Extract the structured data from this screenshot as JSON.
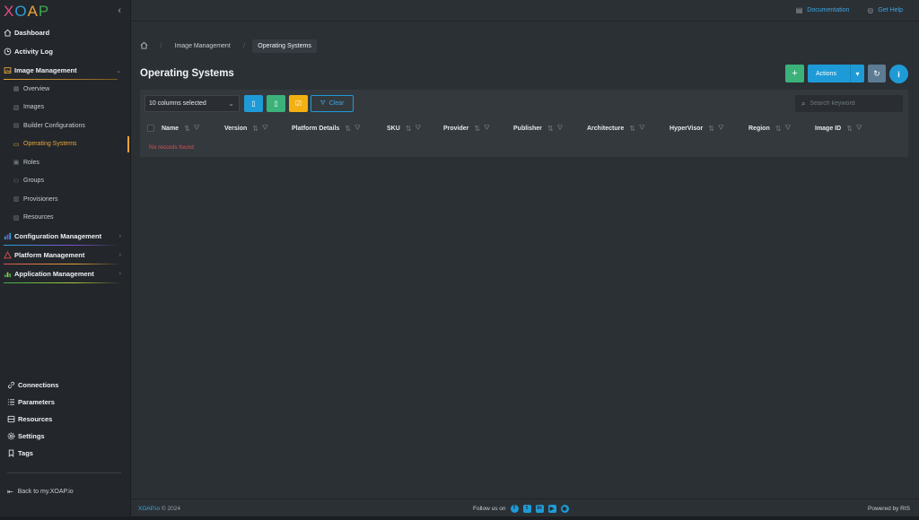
{
  "brand": {
    "logo_letters": [
      "X",
      "O",
      "A",
      "P"
    ],
    "logo_colors": [
      "#e24a8a",
      "#2a9fd6",
      "#e8a33a",
      "#3ea84f"
    ]
  },
  "sidebar": {
    "collapse_icon": "chevron-left-icon",
    "items": [
      {
        "label": "Dashboard",
        "icon": "home-icon"
      },
      {
        "label": "Activity Log",
        "icon": "clock-icon"
      },
      {
        "label": "Image Management",
        "icon": "image-icon",
        "expanded": true
      }
    ],
    "image_management_children": [
      {
        "label": "Overview",
        "icon": "grid-icon"
      },
      {
        "label": "Images",
        "icon": "image-icon"
      },
      {
        "label": "Builder Configurations",
        "icon": "config-icon"
      },
      {
        "label": "Operating Systems",
        "icon": "monitor-icon",
        "active": true
      },
      {
        "label": "Roles",
        "icon": "roles-icon"
      },
      {
        "label": "Groups",
        "icon": "groups-icon"
      },
      {
        "label": "Provisioners",
        "icon": "provisioner-icon"
      },
      {
        "label": "Resources",
        "icon": "resources-icon"
      }
    ],
    "sections": [
      {
        "label": "Configuration Management",
        "icon": "chart-icon"
      },
      {
        "label": "Platform Management",
        "icon": "triangle-icon"
      },
      {
        "label": "Application Management",
        "icon": "bars-icon"
      }
    ],
    "bottom_items": [
      {
        "label": "Connections",
        "icon": "link-icon"
      },
      {
        "label": "Parameters",
        "icon": "list-icon"
      },
      {
        "label": "Resources",
        "icon": "database-icon"
      },
      {
        "label": "Settings",
        "icon": "gear-icon"
      },
      {
        "label": "Tags",
        "icon": "bookmark-icon"
      }
    ],
    "back_link": "Back to my.XOAP.io"
  },
  "topbar": {
    "documentation": "Documentation",
    "get_help": "Get Help"
  },
  "breadcrumb": {
    "items": [
      "Image Management",
      "Operating Systems"
    ]
  },
  "page": {
    "title": "Operating Systems",
    "actions_label": "Actions"
  },
  "table": {
    "columns_selected": "10 columns selected",
    "clear_label": "Clear",
    "search_placeholder": "Search keyword",
    "columns": [
      "Name",
      "Version",
      "Platform Details",
      "SKU",
      "Provider",
      "Publisher",
      "Architecture",
      "HyperVisor",
      "Region",
      "Image ID"
    ],
    "empty_message": "No records found"
  },
  "footer": {
    "brand": "XOAP.io",
    "year": "© 2024",
    "follow": "Follow us on",
    "social": [
      "facebook-icon",
      "twitter-icon",
      "linkedin-icon",
      "youtube-icon",
      "github-icon"
    ],
    "powered": "Powered by RIS"
  },
  "colors": {
    "accent_blue": "#1e9bd7",
    "accent_green": "#3ab27a",
    "accent_yellow": "#f3b012",
    "active_orange": "#e8a33a",
    "error_red": "#d9534f"
  }
}
